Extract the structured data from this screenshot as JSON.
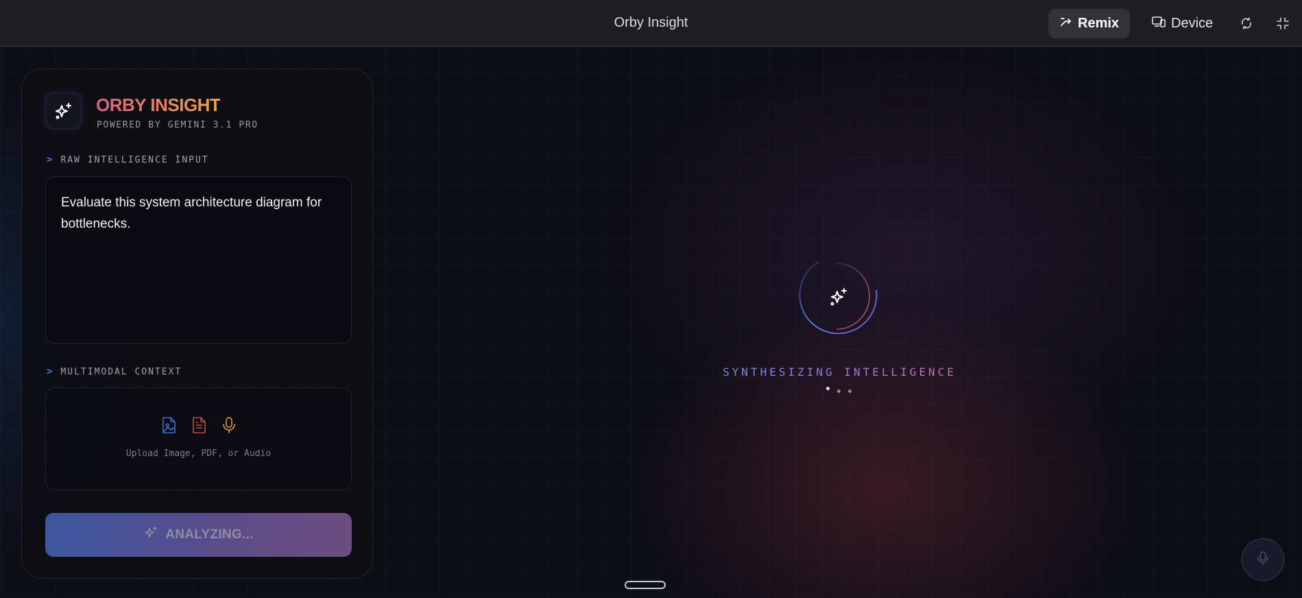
{
  "window": {
    "title": "Orby Insight"
  },
  "toolbar": {
    "remix_label": "Remix",
    "device_label": "Device",
    "icons": [
      "remix-icon",
      "device-icon",
      "refresh-icon",
      "fullscreen-icon"
    ]
  },
  "brand": {
    "title": "ORBY INSIGHT",
    "subtitle": "POWERED BY GEMINI 3.1 PRO",
    "icon": "sparkle-icon"
  },
  "raw_input": {
    "label": "RAW INTELLIGENCE INPUT",
    "value": "Evaluate this system architecture diagram for bottlenecks."
  },
  "multimodal": {
    "label": "MULTIMODAL CONTEXT",
    "upload_text": "Upload Image, PDF, or Audio",
    "icons": [
      "image-file-icon",
      "document-icon",
      "microphone-icon"
    ]
  },
  "analyze_button": {
    "label": "ANALYZING...",
    "disabled": true
  },
  "status": {
    "text": "SYNTHESIZING INTELLIGENCE"
  },
  "colors": {
    "accent_blue": "#4e7bd8",
    "accent_pink": "#d85f86",
    "accent_orange": "#f2a246",
    "icon_red": "#c94a4a",
    "icon_amber": "#d19a2a"
  }
}
